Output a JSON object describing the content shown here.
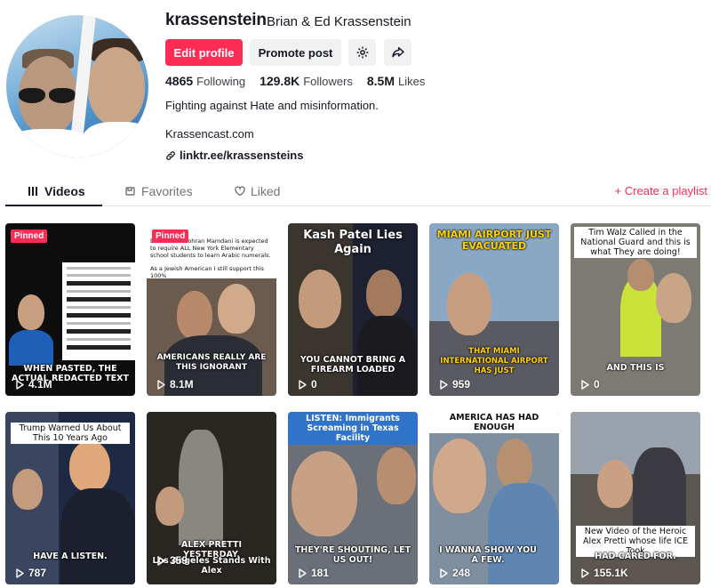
{
  "profile": {
    "username": "krassenstein",
    "nickname": "Brian & Ed Krassenstein",
    "edit_label": "Edit profile",
    "promote_label": "Promote post",
    "bio": "Fighting against Hate and misinformation.",
    "bio_line2": "Krassencast.com",
    "link": "linktr.ee/krassensteins",
    "stats": [
      {
        "value": "4865",
        "label": "Following"
      },
      {
        "value": "129.8K",
        "label": "Followers"
      },
      {
        "value": "8.5M",
        "label": "Likes"
      }
    ]
  },
  "tabs": {
    "videos": "Videos",
    "favorites": "Favorites",
    "liked": "Liked",
    "playlist": "+ Create a playlist"
  },
  "videos": [
    {
      "views": "4.1M",
      "pinned": "Pinned",
      "caption": "WHEN PASTED, THE ACTUAL REDACTED TEXT"
    },
    {
      "views": "8.1M",
      "pinned": "Pinned",
      "top_text": "BREAKING: Zohran Mamdani is expected to require ALL New York Elementary school students to learn Arabic numerals.",
      "top_text2": "As a Jewish American I still support this 100%",
      "caption": "AMERICANS REALLY ARE THIS IGNORANT"
    },
    {
      "views": "0",
      "headline": "Kash Patel Lies Again",
      "caption": "YOU CANNOT BRING A FIREARM LOADED"
    },
    {
      "views": "959",
      "headline": "MIAMI AIRPORT JUST EVACUATED",
      "caption": "THAT MIAMI INTERNATIONAL AIRPORT HAS JUST"
    },
    {
      "views": "0",
      "top_text": "Tim Walz Called in the National Guard and this is what They are doing!",
      "caption": "AND THIS IS"
    },
    {
      "views": "787",
      "top_text": "Trump Warned Us About This 10 Years Ago",
      "caption": "HAVE A LISTEN."
    },
    {
      "views": "359",
      "caption": "ALEX PRETTI YESTERDAY,",
      "caption2": "Los Angeles Stands With Alex"
    },
    {
      "views": "181",
      "top_text": "LISTEN: Immigrants Screaming in Texas Facility",
      "caption": "THEY'RE SHOUTING, LET US OUT!"
    },
    {
      "views": "248",
      "top_text": "AMERICA HAS HAD ENOUGH",
      "caption": "I WANNA SHOW YOU A FEW."
    },
    {
      "views": "155.1K",
      "top_text": "New Video of the Heroic Alex Pretti whose life ICE Took",
      "caption": "HAD CARED FOR."
    }
  ],
  "colors": {
    "accent": "#fe2c55",
    "text": "#161823",
    "button_bg": "#f1f1f2"
  }
}
